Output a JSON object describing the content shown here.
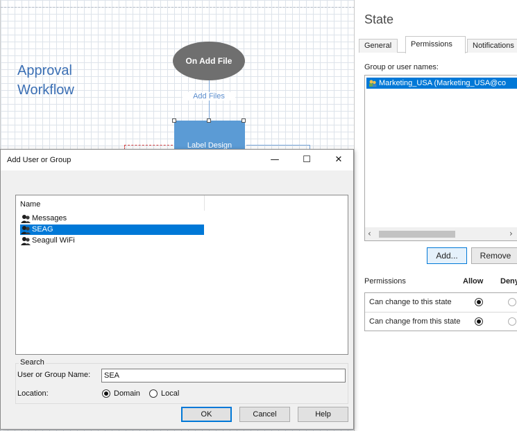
{
  "canvas": {
    "workflow_title": "Approval Workflow",
    "start_node": "On Add File",
    "transition_label": "Add Files",
    "state_node": "Label Design"
  },
  "panel": {
    "title": "State",
    "tabs": [
      {
        "label": "General",
        "active": false
      },
      {
        "label": "Permissions",
        "active": true
      },
      {
        "label": "Notifications",
        "active": false
      }
    ],
    "group_label": "Group or user names:",
    "selected_user": "Marketing_USA (Marketing_USA@co",
    "add_label": "Add...",
    "remove_label": "Remove",
    "permissions_header": "Permissions",
    "allow_header": "Allow",
    "deny_header": "Deny",
    "permissions": [
      {
        "label": "Can change to this state",
        "allow": true,
        "deny": false
      },
      {
        "label": "Can change from this state",
        "allow": true,
        "deny": false
      }
    ]
  },
  "dialog": {
    "title": "Add User or Group",
    "list_header": "Name",
    "items": [
      {
        "name": "Messages",
        "selected": false
      },
      {
        "name": "SEAG",
        "selected": true
      },
      {
        "name": "Seagull WiFi",
        "selected": false
      }
    ],
    "search_legend": "Search",
    "search_label": "User or Group Name:",
    "search_value": "SEA",
    "location_label": "Location:",
    "location_options": [
      {
        "label": "Domain",
        "checked": true
      },
      {
        "label": "Local",
        "checked": false
      }
    ],
    "ok_label": "OK",
    "cancel_label": "Cancel",
    "help_label": "Help"
  },
  "colors": {
    "accent": "#0078d7",
    "title_blue": "#3b6fb4",
    "state_node": "#5b9bd5",
    "start_node": "#6f6f6f"
  }
}
